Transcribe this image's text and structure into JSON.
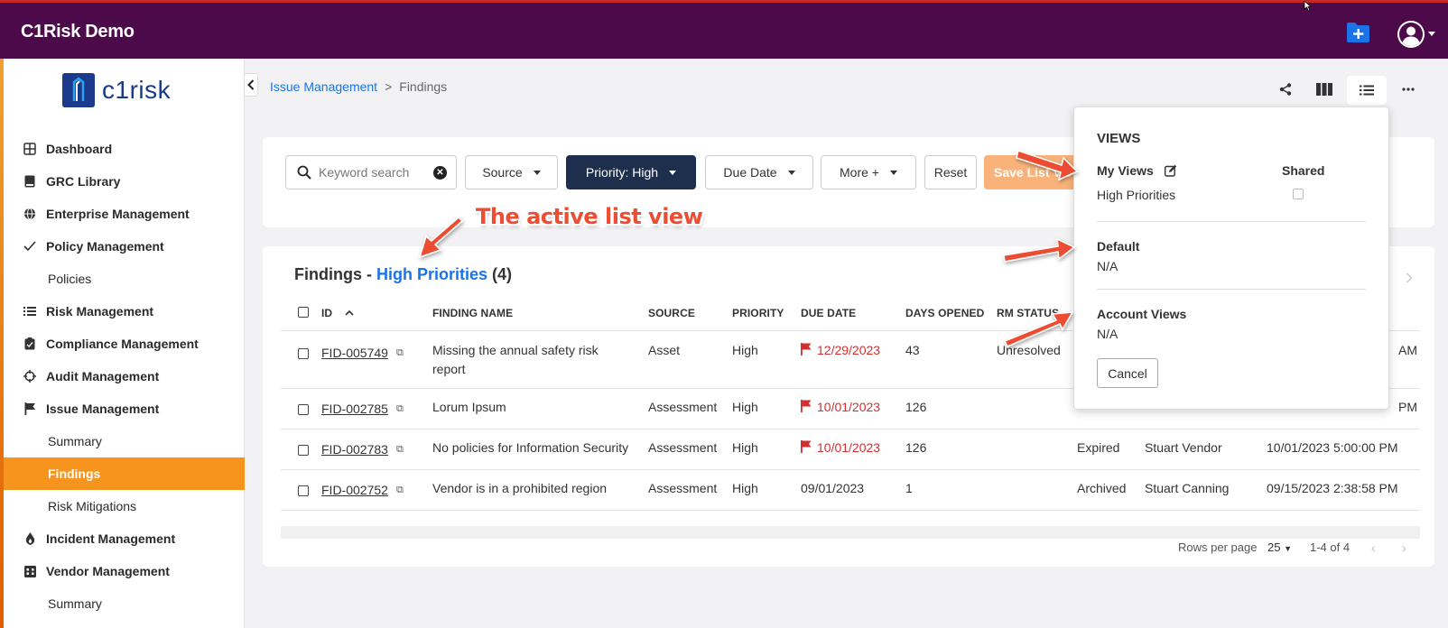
{
  "app": {
    "title": "C1Risk Demo",
    "logo_text": "c1risk"
  },
  "topbar": {
    "add_icon": "folder-plus-icon",
    "avatar_icon": "user-circle-icon"
  },
  "sidebar": {
    "items": [
      {
        "label": "Dashboard",
        "icon": "grid-icon",
        "type": "section"
      },
      {
        "label": "GRC Library",
        "icon": "book-icon",
        "type": "section"
      },
      {
        "label": "Enterprise Management",
        "icon": "globe-icon",
        "type": "section"
      },
      {
        "label": "Policy Management",
        "icon": "check-icon",
        "type": "section"
      },
      {
        "label": "Policies",
        "type": "sub"
      },
      {
        "label": "Risk Management",
        "icon": "list-icon",
        "type": "section"
      },
      {
        "label": "Compliance Management",
        "icon": "clipboard-check-icon",
        "type": "section"
      },
      {
        "label": "Audit Management",
        "icon": "crosshair-icon",
        "type": "section"
      },
      {
        "label": "Issue Management",
        "icon": "flag-icon",
        "type": "section"
      },
      {
        "label": "Summary",
        "type": "sub"
      },
      {
        "label": "Findings",
        "type": "sub",
        "active": true
      },
      {
        "label": "Risk Mitigations",
        "type": "sub"
      },
      {
        "label": "Incident Management",
        "icon": "fire-icon",
        "type": "section"
      },
      {
        "label": "Vendor Management",
        "icon": "building-icon",
        "type": "section"
      },
      {
        "label": "Summary",
        "type": "sub"
      }
    ]
  },
  "breadcrumb": {
    "parent": "Issue Management",
    "separator": ">",
    "current": "Findings"
  },
  "filters": {
    "search_placeholder": "Keyword search",
    "source": "Source",
    "priority": "Priority: High",
    "due_date": "Due Date",
    "more": "More +",
    "reset": "Reset",
    "save_view": "Save List View"
  },
  "findings": {
    "title": "Findings - ",
    "view_name": "High Priorities",
    "count": "(4)",
    "columns": [
      "ID",
      "FINDING NAME",
      "SOURCE",
      "PRIORITY",
      "DUE DATE",
      "DAYS OPENED",
      "RM STATUS"
    ],
    "rows": [
      {
        "id": "FID-005749",
        "name": "Missing the annual safety risk report",
        "source": "Asset",
        "priority": "High",
        "due": "12/29/2023",
        "overdue": true,
        "days": "43",
        "rm_status": "Unresolved",
        "status": "",
        "owner": "",
        "updated_tail": "AM"
      },
      {
        "id": "FID-002785",
        "name": "Lorum Ipsum",
        "source": "Assessment",
        "priority": "High",
        "due": "10/01/2023",
        "overdue": true,
        "days": "126",
        "rm_status": "",
        "status": "Expired",
        "owner": "Stuart Vendor",
        "updated_tail": "PM"
      },
      {
        "id": "FID-002783",
        "name": "No policies for Information Security",
        "source": "Assessment",
        "priority": "High",
        "due": "10/01/2023",
        "overdue": true,
        "days": "126",
        "rm_status": "",
        "status": "Expired",
        "owner": "Stuart Vendor",
        "updated": "10/01/2023 5:00:00 PM"
      },
      {
        "id": "FID-002752",
        "name": "Vendor is in a prohibited region",
        "source": "Assessment",
        "priority": "High",
        "due": "09/01/2023",
        "overdue": false,
        "days": "1",
        "rm_status": "",
        "status": "Archived",
        "owner": "Stuart Canning",
        "updated": "09/15/2023 2:38:58 PM"
      }
    ],
    "footer": {
      "rows_per_page_label": "Rows per page",
      "rows_per_page": "25",
      "range": "1-4 of 4"
    }
  },
  "views_panel": {
    "heading": "VIEWS",
    "my_views": "My Views",
    "shared": "Shared",
    "my_view_item": "High Priorities",
    "default_label": "Default",
    "default_value": "N/A",
    "account_label": "Account Views",
    "account_value": "N/A",
    "cancel": "Cancel"
  },
  "annotation": {
    "text": "The active list view",
    "color": "#ec4d33"
  },
  "colors": {
    "topbar": "#4d0a4a",
    "active_nav": "#f7941d",
    "primary_filter": "#1e2f4d",
    "link": "#1a73e8",
    "overdue": "#d32f2f",
    "add_button": "#1a73e8"
  }
}
